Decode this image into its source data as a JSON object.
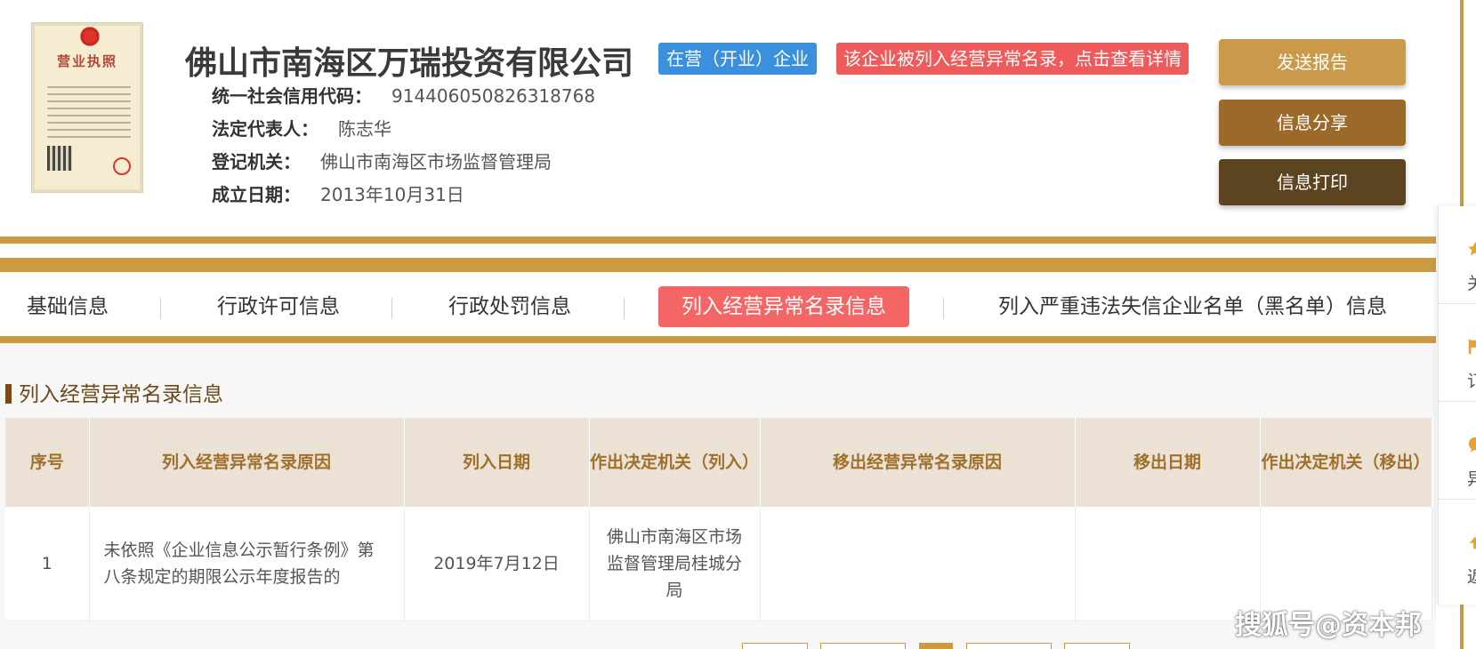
{
  "company": {
    "name": "佛山市南海区万瑞投资有限公司",
    "status_badge": "在营（开业）企业",
    "alert_badge": "该企业被列入经营异常名录，点击查看详情",
    "license_title": "营业执照"
  },
  "info": [
    {
      "label": "统一社会信用代码：",
      "value": "914406050826318768"
    },
    {
      "label": "法定代表人：",
      "value": "陈志华"
    },
    {
      "label": "登记机关：",
      "value": "佛山市南海区市场监督管理局"
    },
    {
      "label": "成立日期：",
      "value": "2013年10月31日"
    }
  ],
  "actions": {
    "send": "发送报告",
    "share": "信息分享",
    "print": "信息打印"
  },
  "tabs": [
    {
      "label": "基础信息"
    },
    {
      "label": "行政许可信息"
    },
    {
      "label": "行政处罚信息"
    },
    {
      "label": "列入经营异常名录信息"
    },
    {
      "label": "列入严重违法失信企业名单（黑名单）信息"
    }
  ],
  "active_tab_index": 3,
  "section": {
    "title": "列入经营异常名录信息"
  },
  "table": {
    "headers": [
      "序号",
      "列入经营异常名录原因",
      "列入日期",
      "作出决定机关（列入）",
      "移出经营异常名录原因",
      "移出日期",
      "作出决定机关（移出）"
    ],
    "rows": [
      [
        "1",
        "未依照《企业信息公示暂行条例》第八条规定的期限公示年度报告的",
        "2019年7月12日",
        "佛山市南海区市场监督管理局桂城分局",
        "",
        "",
        ""
      ]
    ]
  },
  "side_panel": [
    {
      "icon": "star-icon",
      "label": "关"
    },
    {
      "icon": "flag-icon",
      "label": "订"
    },
    {
      "icon": "chat-icon",
      "label": "异"
    },
    {
      "icon": "arrow-up-icon",
      "label": "返"
    }
  ],
  "watermark": "搜狐号@资本邦",
  "colors": {
    "gold": "#cc9a40",
    "status_blue": "#3b90de",
    "alert_red": "#ef5b5b",
    "active_tab": "#f46565",
    "btn_send": "#c99a4a",
    "btn_share": "#9b6a2a",
    "btn_print": "#5d4420"
  }
}
